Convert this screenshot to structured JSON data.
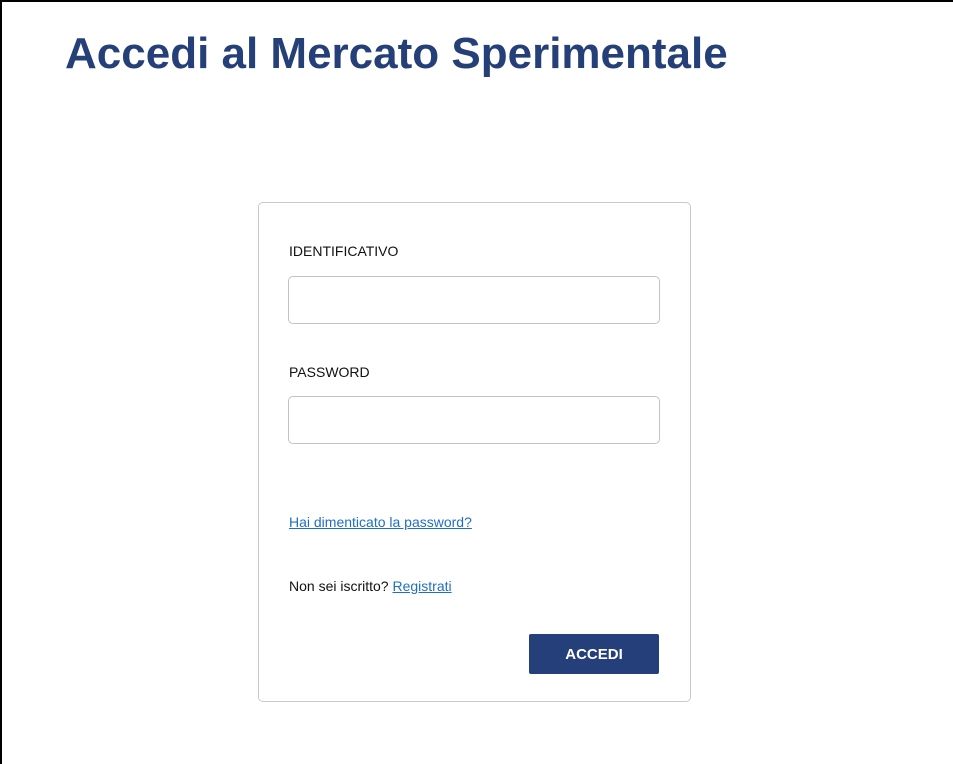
{
  "page": {
    "title": "Accedi al Mercato Sperimentale"
  },
  "login": {
    "identifier_label": "IDENTIFICATIVO",
    "identifier_value": "",
    "password_label": "PASSWORD",
    "password_value": "",
    "forgot_password_link": "Hai dimenticato la password?",
    "register_prompt": "Non sei iscritto?",
    "register_link": "Registrati",
    "submit_label": "ACCEDI"
  },
  "colors": {
    "title": "#254079",
    "button_background": "#253f7a",
    "link": "#1f6fc5",
    "box_border": "#c9c9c9"
  }
}
